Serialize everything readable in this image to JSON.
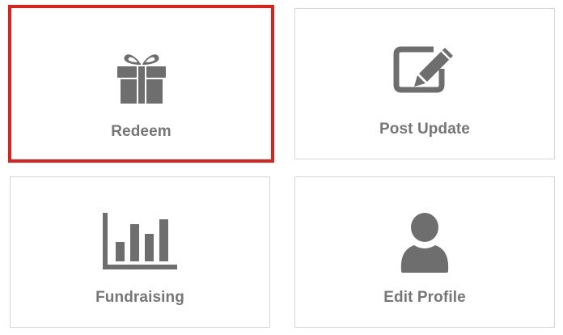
{
  "tiles": [
    {
      "label": "Redeem",
      "icon": "gift-icon",
      "selected": true
    },
    {
      "label": "Post Update",
      "icon": "edit-icon",
      "selected": false
    },
    {
      "label": "Fundraising",
      "icon": "bar-chart-icon",
      "selected": false
    },
    {
      "label": "Edit Profile",
      "icon": "user-icon",
      "selected": false
    }
  ],
  "colors": {
    "icon": "#6e6e6e",
    "label": "#767676",
    "selected_border": "#e0201b",
    "tile_border": "#d7d7d7"
  }
}
